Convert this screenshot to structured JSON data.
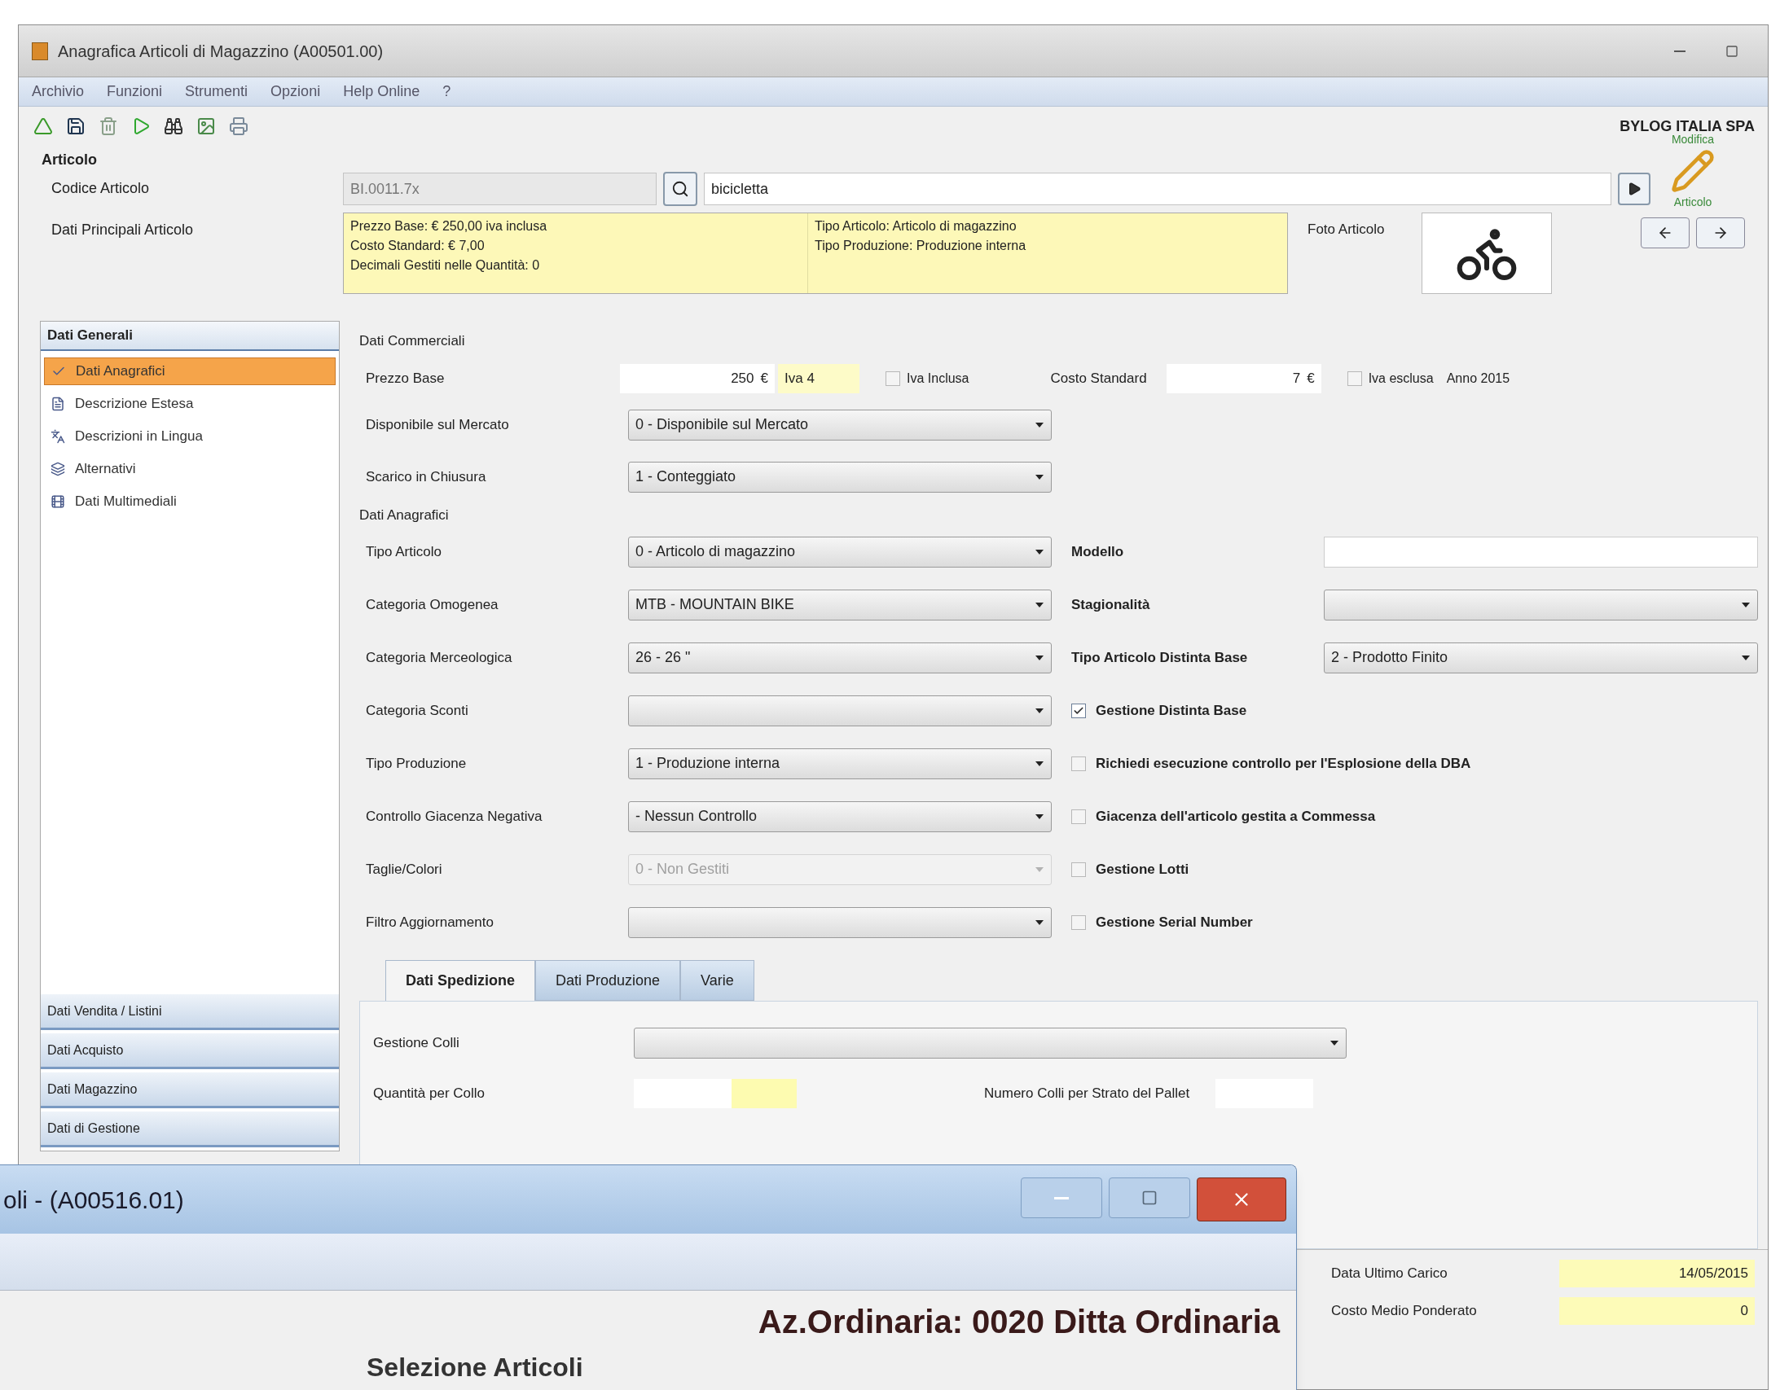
{
  "window": {
    "title": "Anagrafica Articoli di Magazzino (A00501.00)"
  },
  "menu": [
    "Archivio",
    "Funzioni",
    "Strumenti",
    "Opzioni",
    "Help Online",
    "?"
  ],
  "company": "BYLOG ITALIA SPA",
  "header": {
    "section": "Articolo",
    "code_label": "Codice Articolo",
    "code_value": "BI.0011.7x",
    "description": "bicicletta",
    "main_label": "Dati Principali Articolo",
    "summary_left": [
      "Prezzo Base: € 250,00 iva inclusa",
      "Costo Standard: € 7,00",
      "Decimali Gestiti nelle Quantità: 0"
    ],
    "summary_right": [
      "Tipo Articolo: Articolo di magazzino",
      "Tipo Produzione: Produzione interna"
    ],
    "photo_label": "Foto Articolo",
    "edit_top": "Modifica",
    "edit_bottom": "Articolo"
  },
  "sidebar": {
    "title": "Dati Generali",
    "items": [
      {
        "label": "Dati Anagrafici",
        "selected": true
      },
      {
        "label": "Descrizione Estesa",
        "selected": false
      },
      {
        "label": "Descrizioni in Lingua",
        "selected": false
      },
      {
        "label": "Alternativi",
        "selected": false
      },
      {
        "label": "Dati Multimediali",
        "selected": false
      }
    ],
    "sections": [
      "Dati Vendita / Listini",
      "Dati Acquisto",
      "Dati Magazzino",
      "Dati di Gestione"
    ]
  },
  "commercial": {
    "title": "Dati Commerciali",
    "price": {
      "label": "Prezzo Base",
      "value": "250",
      "currency": "€",
      "vat": "Iva 4",
      "vat_included": {
        "label": "Iva Inclusa",
        "checked": false
      }
    },
    "cost": {
      "label": "Costo Standard",
      "value": "7",
      "currency": "€",
      "vat_excluded": {
        "label": "Iva esclusa",
        "checked": false
      },
      "year": "Anno 2015"
    },
    "rows": [
      {
        "label": "Disponibile sul Mercato",
        "value": "0 - Disponibile sul Mercato"
      },
      {
        "label": "Scarico in Chiusura",
        "value": "1 - Conteggiato"
      }
    ]
  },
  "registry": {
    "title": "Dati Anagrafici",
    "rows": [
      {
        "label": "Tipo Articolo",
        "value": "0 - Articolo di magazzino",
        "disabled": false,
        "right": {
          "kind": "input",
          "label": "Modello"
        }
      },
      {
        "label": "Categoria Omogenea",
        "value": "MTB - MOUNTAIN BIKE",
        "disabled": false,
        "right": {
          "kind": "select",
          "label": "Stagionalità"
        }
      },
      {
        "label": "Categoria Merceologica",
        "value": "26 - 26 \"",
        "disabled": false,
        "right": {
          "kind": "select",
          "label": "Tipo Articolo Distinta Base",
          "value": "2 - Prodotto Finito"
        }
      },
      {
        "label": "Categoria Sconti",
        "disabled": false,
        "right": {
          "kind": "checkbox",
          "label": "Gestione Distinta Base",
          "checked": true
        }
      },
      {
        "label": "Tipo Produzione",
        "value": "1 - Produzione interna",
        "disabled": false,
        "right": {
          "kind": "checkbox",
          "label": "Richiedi esecuzione controllo per l'Esplosione della DBA",
          "checked": false
        }
      },
      {
        "label": "Controllo Giacenza Negativa",
        "value": "- Nessun Controllo",
        "disabled": false,
        "right": {
          "kind": "checkbox",
          "label": "Giacenza dell'articolo gestita a Commessa",
          "checked": false
        }
      },
      {
        "label": "Taglie/Colori",
        "value": "0 - Non Gestiti",
        "disabled": true,
        "right": {
          "kind": "checkbox",
          "label": "Gestione Lotti",
          "checked": false
        }
      },
      {
        "label": "Filtro Aggiornamento",
        "disabled": false,
        "right": {
          "kind": "checkbox",
          "label": "Gestione Serial Number",
          "checked": false
        }
      }
    ]
  },
  "tabs": [
    {
      "label": "Dati Spedizione",
      "selected": true
    },
    {
      "label": "Dati Produzione",
      "selected": false
    },
    {
      "label": "Varie",
      "selected": false
    }
  ],
  "shipping": {
    "packages_label": "Gestione Colli",
    "qty_label": "Quantità per Collo",
    "layers_label": "Numero Colli per Strato del Pallet"
  },
  "footer": [
    {
      "label": "Data Ultimo Carico",
      "value": "14/05/2015"
    },
    {
      "label": "Costo Medio Ponderato",
      "value": "0"
    }
  ],
  "overlay": {
    "title": "oli - (A00516.01)",
    "company": "Az.Ordinaria: 0020 Ditta Ordinaria",
    "heading": "Selezione Articoli"
  }
}
